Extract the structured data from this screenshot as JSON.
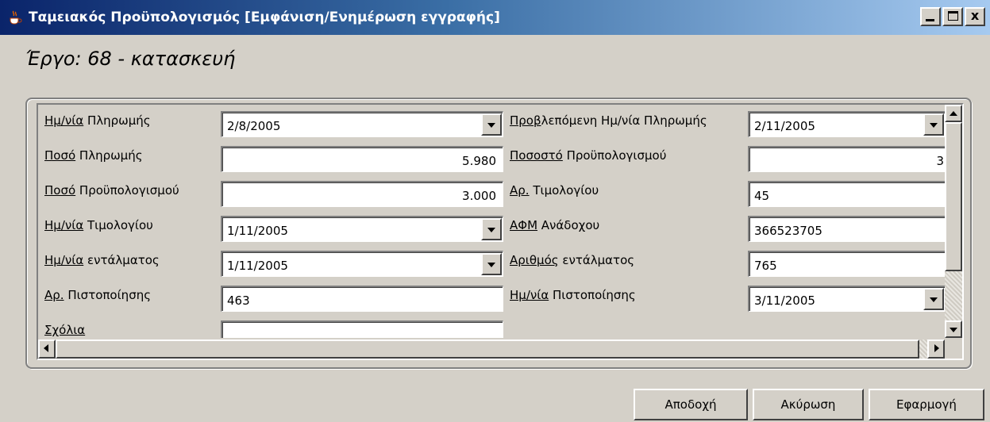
{
  "window": {
    "title": "Ταμειακός Προϋπολογισμός [Εμφάνιση/Ενημέρωση  εγγραφής]",
    "icon": "java-cup-icon",
    "controls": [
      "minimize",
      "maximize",
      "close"
    ],
    "close_glyph": "x"
  },
  "header": {
    "title": "Έργο: 68 - κατασκευή"
  },
  "form": {
    "left": [
      {
        "label_prefix": "",
        "label_ul": "Ημ/νία",
        "label_rest": " Πληρωμής",
        "value": "2/8/2005",
        "type": "combo"
      },
      {
        "label_prefix": "",
        "label_ul": "Ποσό",
        "label_rest": " Πληρωμής",
        "value": "5.980",
        "type": "number"
      },
      {
        "label_prefix": "",
        "label_ul": "Ποσό",
        "label_rest": " Προϋπολογισμού",
        "value": "3.000",
        "type": "number"
      },
      {
        "label_prefix": "",
        "label_ul": "Ημ/νία",
        "label_rest": " Τιμολογίου",
        "value": "1/11/2005",
        "type": "combo"
      },
      {
        "label_prefix": "",
        "label_ul": "Ημ/νία",
        "label_rest": " εντάλματος",
        "value": "1/11/2005",
        "type": "combo"
      },
      {
        "label_prefix": "",
        "label_ul": "Αρ.",
        "label_rest": " Πιστοποίησης",
        "value": "463",
        "type": "text"
      },
      {
        "label_prefix": "",
        "label_ul": "Σχόλια",
        "label_rest": "",
        "value": "",
        "type": "text"
      }
    ],
    "right": [
      {
        "label_prefix": "",
        "label_ul": "Προβ",
        "label_rest": "λεπόμενη Ημ/νία Πληρωμής",
        "value": "2/11/2005",
        "type": "combo"
      },
      {
        "label_prefix": "",
        "label_ul": "Ποσοστό",
        "label_rest": " Προϋπολογισμού",
        "value": "3",
        "type": "number"
      },
      {
        "label_prefix": "",
        "label_ul": "Αρ.",
        "label_rest": " Τιμολογίου",
        "value": "45",
        "type": "text"
      },
      {
        "label_prefix": "",
        "label_ul": "ΑΦΜ",
        "label_rest": " Ανάδοχου",
        "value": "366523705",
        "type": "text"
      },
      {
        "label_prefix": "",
        "label_ul": "Αριθμός",
        "label_rest": " εντάλματος",
        "value": "765",
        "type": "text"
      },
      {
        "label_prefix": "",
        "label_ul": "Ημ/νία",
        "label_rest": " Πιστοποίησης",
        "value": "3/11/2005",
        "type": "combo"
      }
    ]
  },
  "buttons": {
    "accept": "Αποδοχή",
    "cancel": "Ακύρωση",
    "apply": "Εφαρμογή"
  }
}
